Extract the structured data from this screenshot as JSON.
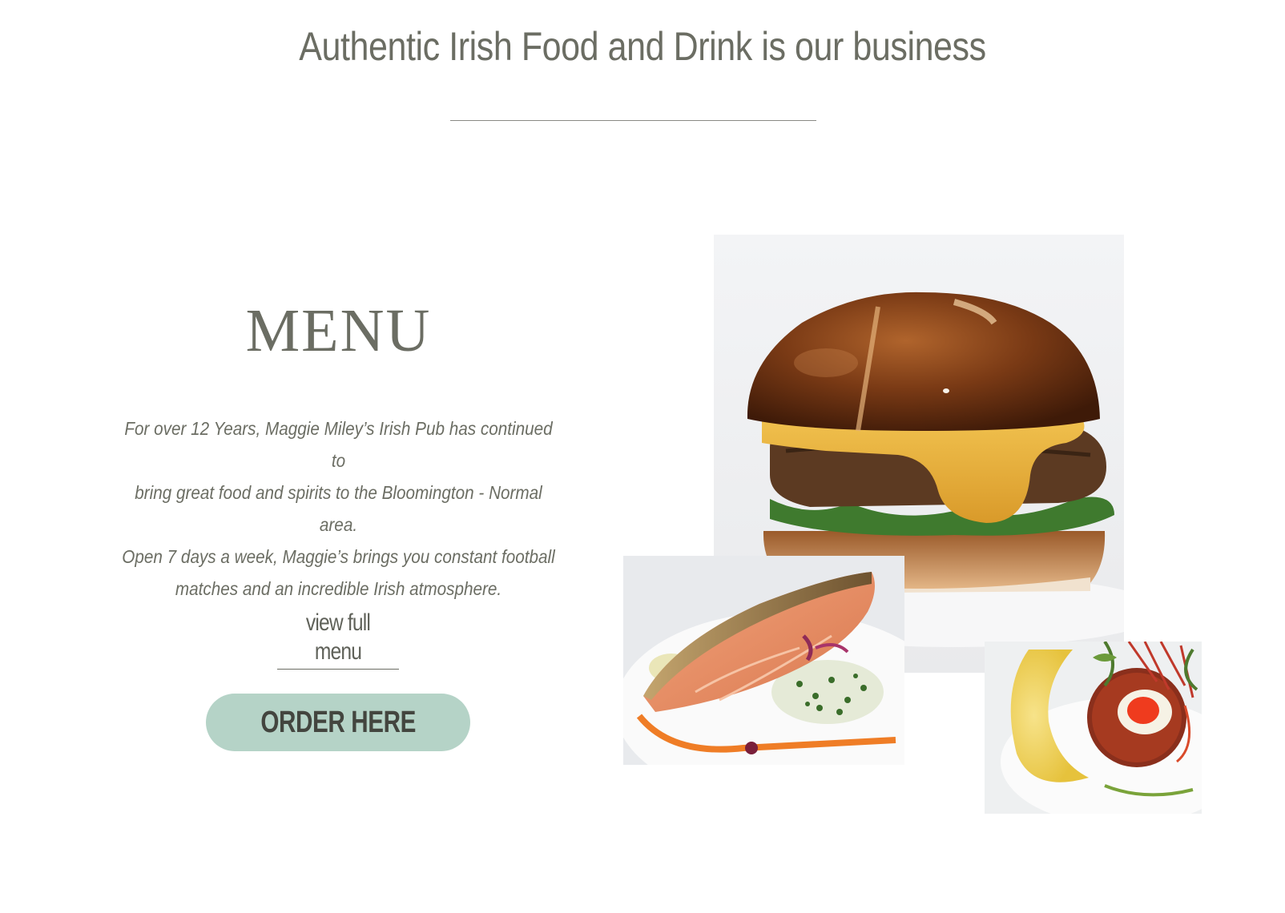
{
  "header": {
    "tagline": "Authentic Irish Food and Drink is our business"
  },
  "menu_section": {
    "heading": "MENU",
    "intro_lines": [
      "For over 12 Years, Maggie Miley’s Irish Pub has continued to",
      "bring great food and spirits to the Bloomington - Normal area.",
      "Open 7 days a week, Maggie’s brings you constant football",
      "matches and an incredible Irish atmosphere."
    ],
    "view_menu_label": "view full menu",
    "order_button_label": "ORDER HERE"
  },
  "photos": [
    {
      "icon": "burger-photo"
    },
    {
      "icon": "salmon-photo"
    },
    {
      "icon": "scotch-egg-photo"
    }
  ],
  "colors": {
    "text": "#6b6d63",
    "order_button_bg": "#b5d3c7",
    "order_button_text": "#43453f",
    "divider": "#8a8a84"
  }
}
